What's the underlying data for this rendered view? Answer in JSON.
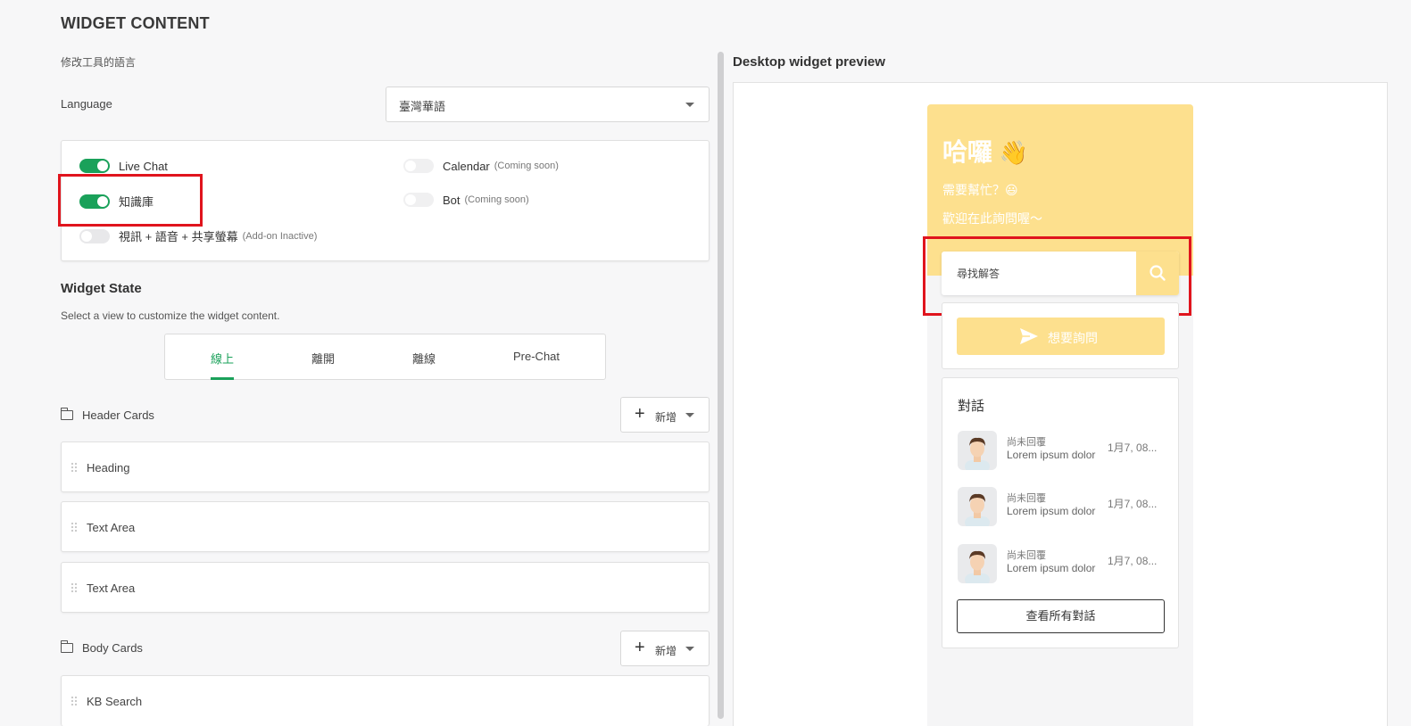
{
  "page_title": "WIDGET CONTENT",
  "language_section": {
    "sub_label": "修改工具的語言",
    "label": "Language",
    "selected": "臺灣華語"
  },
  "channels": [
    {
      "label": "Live Chat",
      "note": "",
      "state": "on"
    },
    {
      "label": "知識庫",
      "note": "",
      "state": "on"
    },
    {
      "label": "視訊 + 語音 + 共享螢幕",
      "note": "(Add-on Inactive)",
      "state": "off"
    },
    {
      "label": "Calendar",
      "note": "(Coming soon)",
      "state": "disabled"
    },
    {
      "label": "Bot",
      "note": "(Coming soon)",
      "state": "disabled"
    }
  ],
  "widget_state": {
    "title": "Widget State",
    "description": "Select a view to customize the widget content.",
    "tabs": [
      {
        "label": "線上",
        "active": true
      },
      {
        "label": "離開",
        "active": false
      },
      {
        "label": "離線",
        "active": false
      },
      {
        "label": "Pre-Chat",
        "active": false
      }
    ]
  },
  "header_cards": {
    "title": "Header Cards",
    "add_label": "新增",
    "items": [
      "Heading",
      "Text Area",
      "Text Area"
    ]
  },
  "body_cards": {
    "title": "Body Cards",
    "add_label": "新增",
    "items": [
      "KB Search"
    ]
  },
  "preview": {
    "title": "Desktop widget preview",
    "greeting": "哈囉",
    "greeting_emoji": "👋",
    "line1": "需要幫忙？😃",
    "line2": "歡迎在此詢問喔～",
    "search_placeholder": "尋找解答",
    "ask_button": "想要詢問",
    "conversations": {
      "title": "對話",
      "items": [
        {
          "status": "尚未回覆",
          "message": "Lorem ipsum dolor",
          "time": "1月7, 08..."
        },
        {
          "status": "尚未回覆",
          "message": "Lorem ipsum dolor",
          "time": "1月7, 08..."
        },
        {
          "status": "尚未回覆",
          "message": "Lorem ipsum dolor",
          "time": "1月7, 08..."
        }
      ],
      "view_all": "查看所有對話"
    },
    "accent_color": "#fde08e"
  },
  "colors": {
    "toggle_on": "#1aa15a",
    "highlight_box": "#e0141d",
    "active_tab": "#1aa15a"
  }
}
